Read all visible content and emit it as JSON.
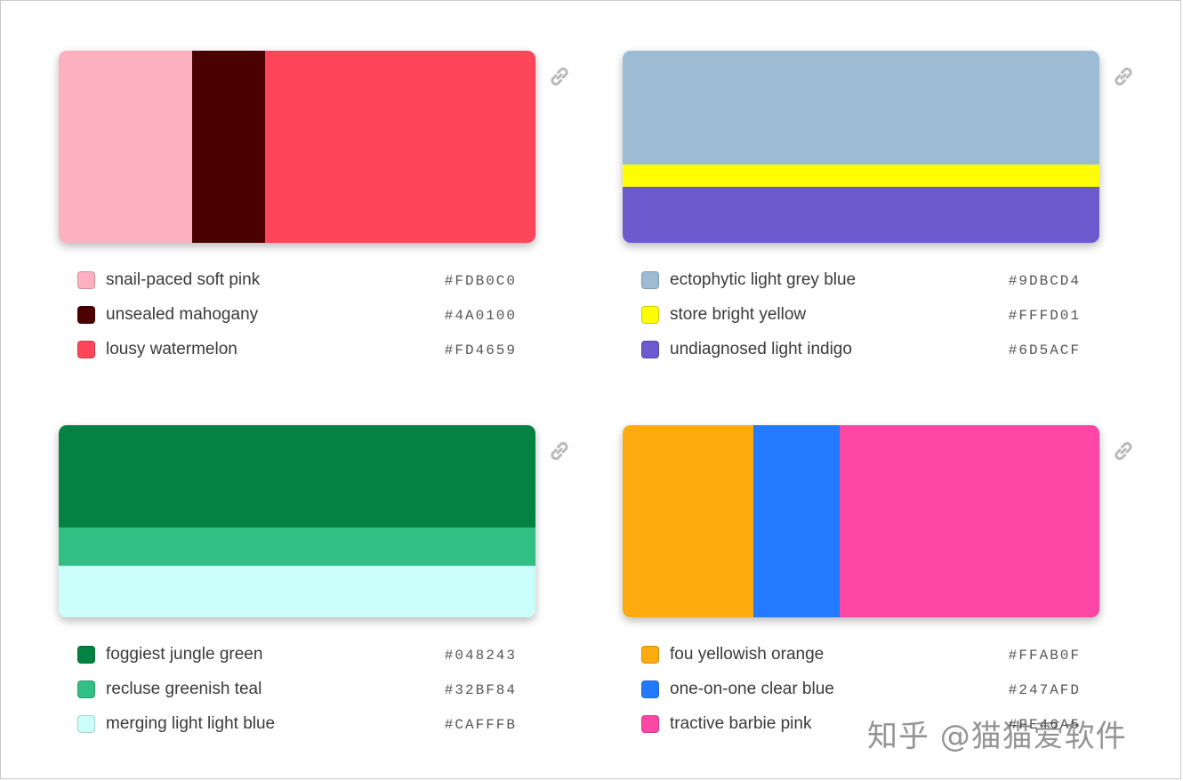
{
  "palettes": [
    {
      "colors": [
        {
          "name": "snail-paced soft pink",
          "hex": "#FDB0C0",
          "flex": 150
        },
        {
          "name": "unsealed mahogany",
          "hex": "#4A0100",
          "flex": 82
        },
        {
          "name": "lousy watermelon",
          "hex": "#FD4659",
          "flex": 304
        }
      ]
    },
    {
      "colors": [
        {
          "name": "ectophytic light grey blue",
          "hex": "#9DBCD4",
          "flex": 128
        },
        {
          "name": "store bright yellow",
          "hex": "#FFFD01",
          "flex": 25
        },
        {
          "name": "undiagnosed light indigo",
          "hex": "#6D5ACF",
          "flex": 63
        }
      ]
    },
    {
      "colors": [
        {
          "name": "foggiest jungle green",
          "hex": "#048243",
          "flex": 115
        },
        {
          "name": "recluse greenish teal",
          "hex": "#32BF84",
          "flex": 43
        },
        {
          "name": "merging light light blue",
          "hex": "#CAFFFB",
          "flex": 58
        }
      ]
    },
    {
      "colors": [
        {
          "name": "fou yellowish orange",
          "hex": "#FFAB0F",
          "flex": 147
        },
        {
          "name": "one-on-one clear blue",
          "hex": "#247AFD",
          "flex": 97
        },
        {
          "name": "tractive barbie pink",
          "hex": "#FE46A5",
          "flex": 292
        }
      ]
    }
  ],
  "watermark": "知乎 @猫猫爱软件",
  "icons": {
    "link": "link-icon"
  }
}
